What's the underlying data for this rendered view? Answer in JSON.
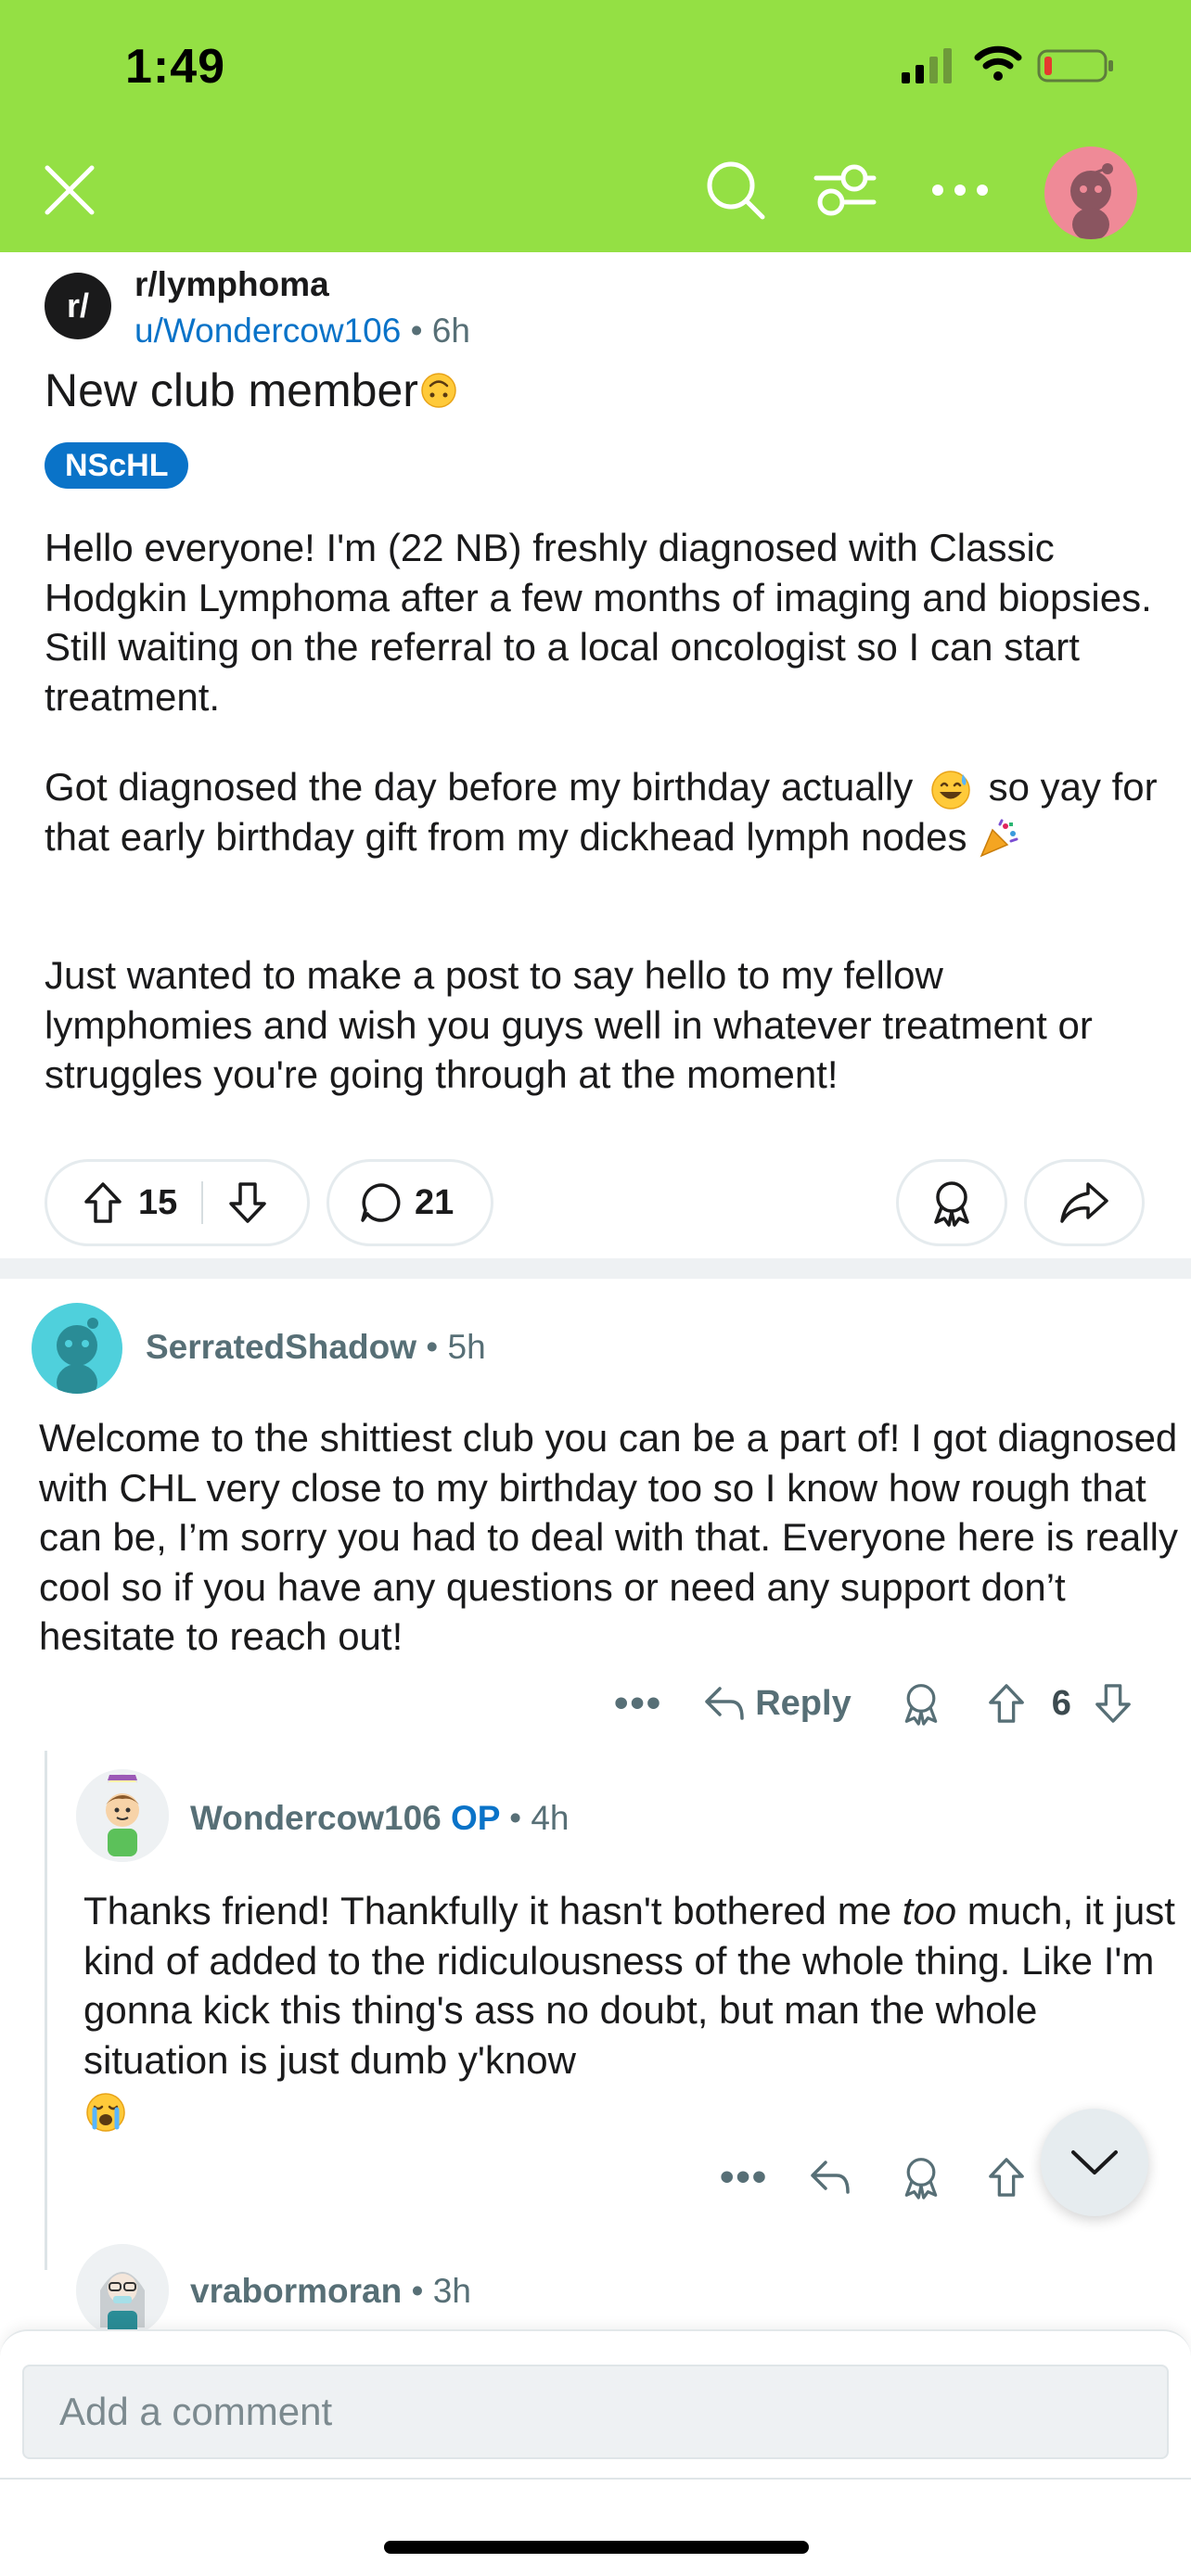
{
  "status_bar": {
    "time": "1:49",
    "icons": [
      "cellular-signal-icon",
      "wifi-icon",
      "battery-low-icon"
    ]
  },
  "nav": {
    "icons": [
      "close-icon",
      "search-icon",
      "sort-icon",
      "more-icon",
      "avatar"
    ],
    "accent_color": "#94e044"
  },
  "post": {
    "subreddit": "r/lymphoma",
    "subreddit_icon_text": "r/",
    "author": "u/Wondercow106",
    "age": "6h",
    "title": "New club member",
    "title_emoji": "upside-down-face",
    "flair": "NScHL",
    "paragraph1": "Hello everyone! I'm (22 NB) freshly diagnosed with Classic Hodgkin Lymphoma after a few months of imaging and biopsies. Still waiting on the referral to a local oncologist so I can start treatment.",
    "paragraph2_a": "Got diagnosed the day before my birthday actually",
    "paragraph2_b": "so yay for that early birthday gift from my dickhead lymph nodes",
    "paragraph3": "Just wanted to make a post to say hello to my fellow lymphomies and wish you guys well in whatever treatment or struggles you're going through at the moment!",
    "score": "15",
    "comment_count": "21"
  },
  "comments": [
    {
      "author": "SerratedShadow",
      "age": "5h",
      "body": "Welcome to the shittiest club you can be a part of! I got diagnosed with CHL very close to my birthday too so I know how rough that can be, I’m sorry you had to deal with that. Everyone here is really cool so if you have any questions or need any support don’t hesitate to reach out!",
      "more": "•••",
      "reply_label": "Reply",
      "score": "6"
    },
    {
      "author": "Wondercow106",
      "op_badge": "OP",
      "age": "4h",
      "body_a": "Thanks friend! Thankfully it hasn't bothered me",
      "body_em": "too",
      "body_b": "much, it just kind of added to the ridiculousness of the whole thing. Like I'm gonna kick this thing's ass no doubt, but man the whole situation is just dumb y'know",
      "more": "•••"
    },
    {
      "author": "vrabormoran",
      "age": "3h"
    }
  ],
  "composer": {
    "placeholder": "Add a comment"
  }
}
